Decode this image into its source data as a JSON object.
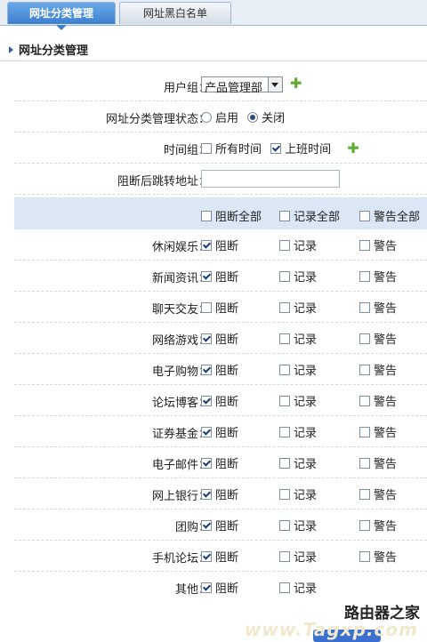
{
  "tabs": [
    {
      "label": "网址分类管理"
    },
    {
      "label": "网址黑白名单"
    }
  ],
  "section_title": "网址分类管理",
  "form": {
    "user_group_label": "用户组：",
    "user_group_value": "产品管理部",
    "status_label": "网址分类管理状态：",
    "status_options": [
      "启用",
      "关闭"
    ],
    "time_group_label": "时间组：",
    "time_options": [
      "所有时间",
      "上班时间"
    ],
    "redirect_label": "阻断后跳转地址：",
    "redirect_value": ""
  },
  "header": {
    "block_all": "阻断全部",
    "record_all": "记录全部",
    "warn_all": "警告全部"
  },
  "option_labels": {
    "block": "阻断",
    "record": "记录",
    "warn": "警告"
  },
  "categories": [
    {
      "label": "休闲娱乐："
    },
    {
      "label": "新闻资讯："
    },
    {
      "label": "聊天交友："
    },
    {
      "label": "网络游戏："
    },
    {
      "label": "电子购物："
    },
    {
      "label": "论坛博客："
    },
    {
      "label": "证券基金："
    },
    {
      "label": "电子邮件："
    },
    {
      "label": "网上银行："
    },
    {
      "label": "团购："
    },
    {
      "label": "手机论坛："
    },
    {
      "label": "其他："
    }
  ],
  "watermark": {
    "line1": "路由器之家",
    "line2": "www.Tagxp.com"
  },
  "colors": {
    "accent": "#3b7fcf",
    "header_bg": "#dce7f5",
    "plus": "#5cae2c"
  }
}
